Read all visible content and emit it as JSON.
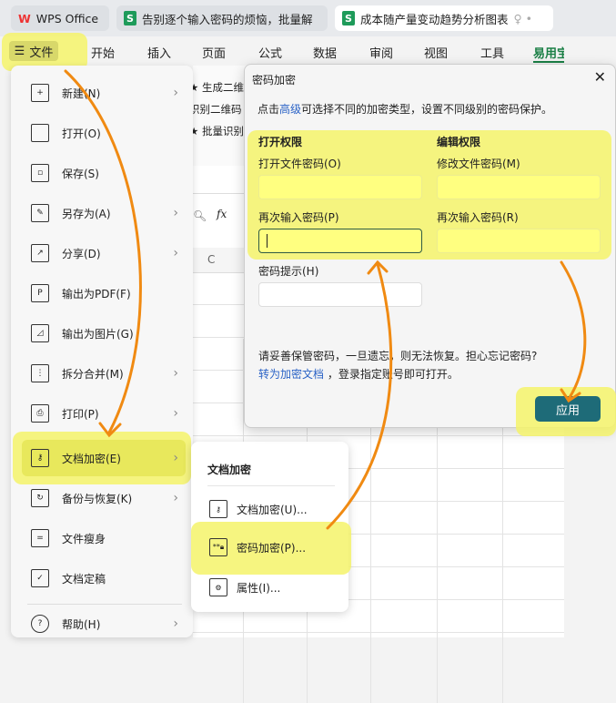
{
  "tabs": [
    {
      "label": "WPS Office"
    },
    {
      "label": "告别逐个输入密码的烦恼，批量解"
    },
    {
      "label": "成本随产量变动趋势分析图表"
    }
  ],
  "menubar": {
    "file": "文件",
    "items": [
      "开始",
      "插入",
      "页面",
      "公式",
      "数据",
      "审阅",
      "视图",
      "工具",
      "易用宝"
    ]
  },
  "ribbon": {
    "items": [
      "★ 生成二维",
      "识别二维码",
      "★ 批量识别"
    ]
  },
  "formula": {
    "fx": "fx",
    "column": "C"
  },
  "file_menu": {
    "items": [
      {
        "label": "新建(N)",
        "icon": "new-file-icon",
        "sub": true
      },
      {
        "label": "打开(O)",
        "icon": "folder-icon",
        "sub": false
      },
      {
        "label": "保存(S)",
        "icon": "save-icon",
        "sub": false
      },
      {
        "label": "另存为(A)",
        "icon": "save-as-icon",
        "sub": true
      },
      {
        "label": "分享(D)",
        "icon": "share-icon",
        "sub": true
      },
      {
        "label": "输出为PDF(F)",
        "icon": "pdf-icon",
        "sub": false
      },
      {
        "label": "输出为图片(G)",
        "icon": "image-icon",
        "sub": false
      },
      {
        "label": "拆分合并(M)",
        "icon": "split-merge-icon",
        "sub": true
      },
      {
        "label": "打印(P)",
        "icon": "print-icon",
        "sub": true
      },
      {
        "label": "文档加密(E)",
        "icon": "doc-encrypt-icon",
        "sub": true
      },
      {
        "label": "备份与恢复(K)",
        "icon": "backup-icon",
        "sub": true
      },
      {
        "label": "文件瘦身",
        "icon": "slim-icon",
        "sub": false
      },
      {
        "label": "文档定稿",
        "icon": "finalize-icon",
        "sub": false
      },
      {
        "label": "帮助(H)",
        "icon": "help-icon",
        "sub": true
      }
    ]
  },
  "submenu": {
    "title": "文档加密",
    "items": [
      {
        "label": "文档加密(U)..."
      },
      {
        "label": "密码加密(P)..."
      },
      {
        "label": "属性(I)..."
      }
    ]
  },
  "dialog": {
    "title": "密码加密",
    "intro_pre": "点击",
    "intro_link": "高级",
    "intro_post": "可选择不同的加密类型，设置不同级别的密码保护。",
    "open_section": "打开权限",
    "edit_section": "编辑权限",
    "open_pwd_label": "打开文件密码(O)",
    "open_pwd_value": "",
    "open_confirm_label": "再次输入密码(P)",
    "open_confirm_value": "",
    "edit_pwd_label": "修改文件密码(M)",
    "edit_pwd_value": "",
    "edit_confirm_label": "再次输入密码(R)",
    "edit_confirm_value": "",
    "hint_label": "密码提示(H)",
    "hint_value": "",
    "warning": "请妥善保管密码，一旦遗忘，则无法恢复。担心忘记密码?",
    "convert_link": "转为加密文档",
    "convert_post": " ，登录指定账号即可打开。",
    "apply": "应用"
  },
  "colors": {
    "highlight": "#f5f36a",
    "arrow": "#f08a12",
    "accent": "#1e6b78",
    "link": "#2b63c6"
  }
}
